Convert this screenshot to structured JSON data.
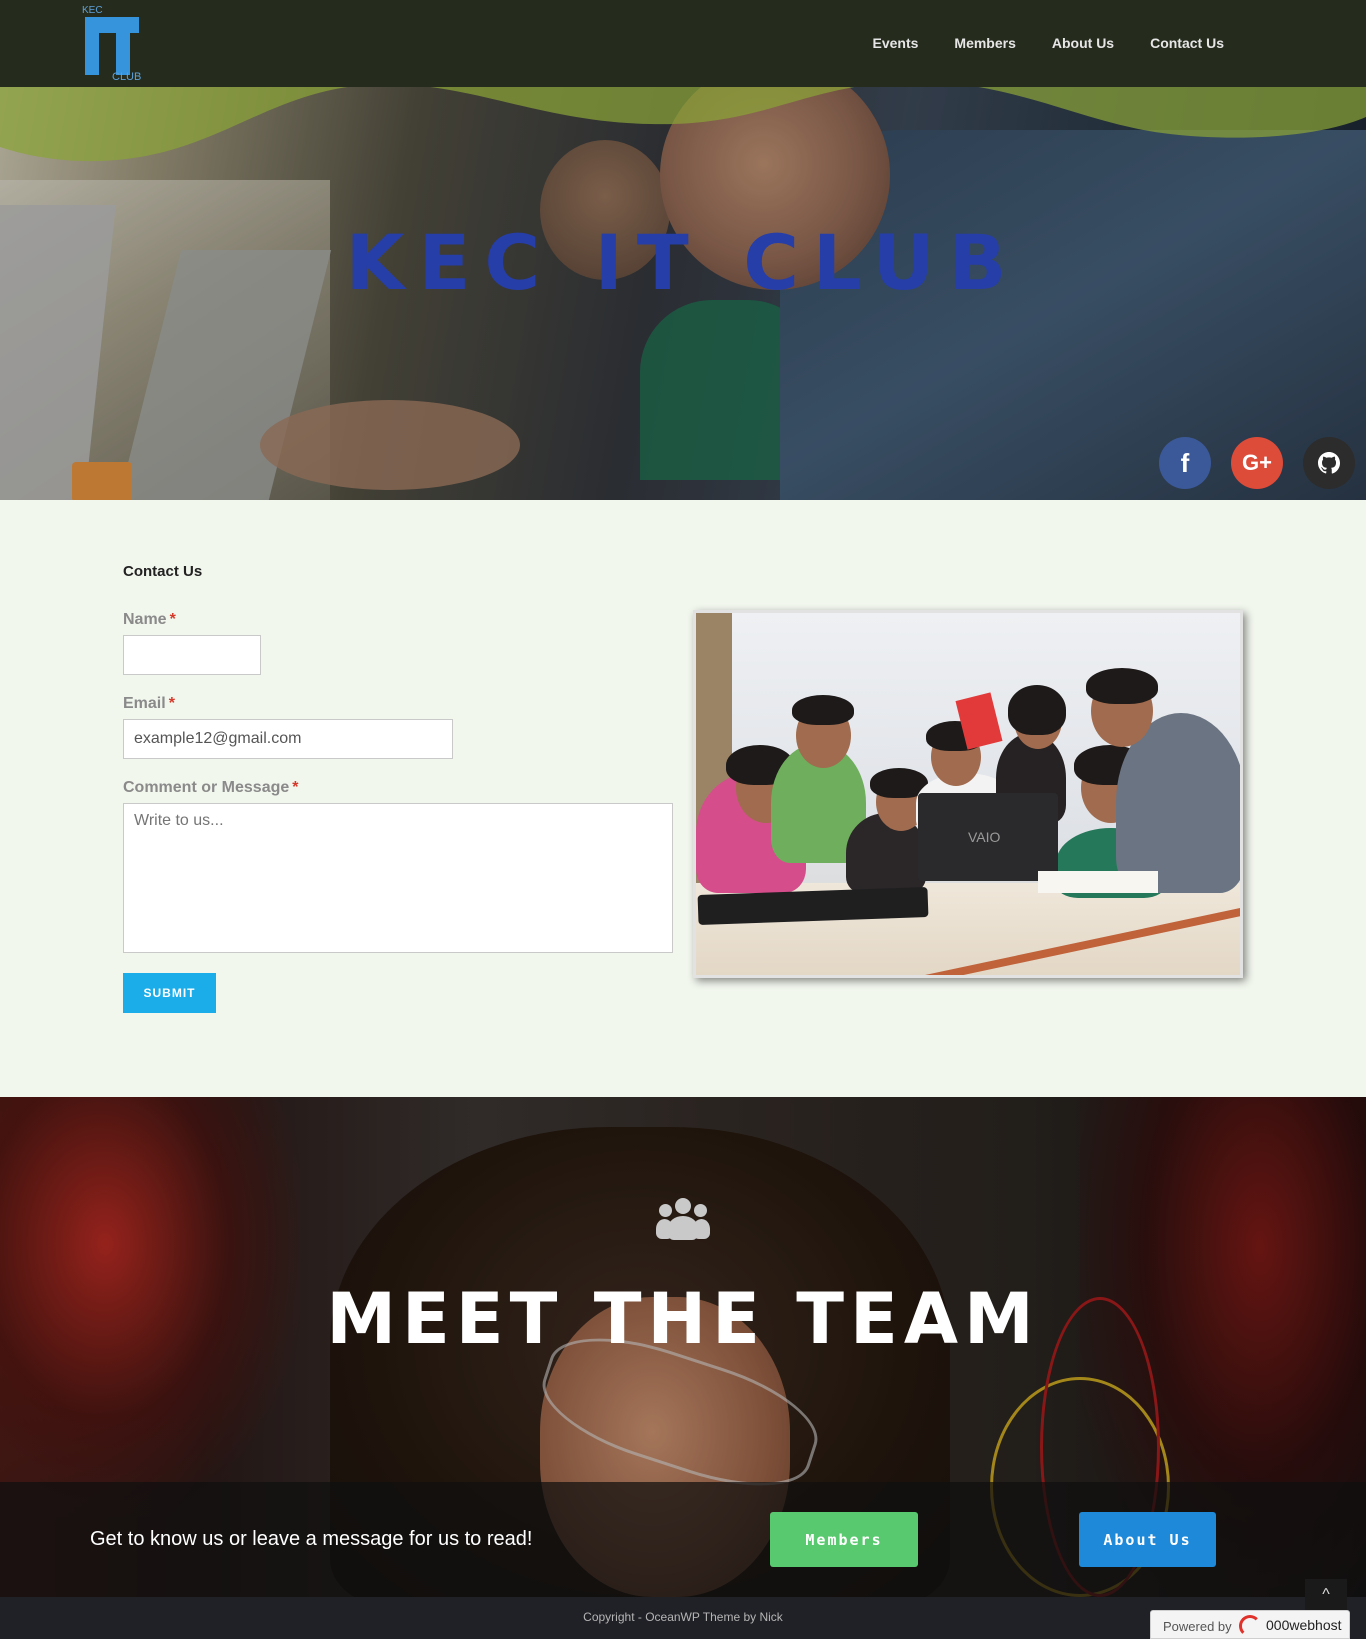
{
  "header": {
    "logo": {
      "top_text": "KEC",
      "main_text": "IT",
      "bottom_text": "CLUB"
    },
    "nav": [
      "Events",
      "Members",
      "About Us",
      "Contact Us"
    ]
  },
  "hero": {
    "title": "KEC IT CLUB",
    "socials": [
      {
        "name": "facebook",
        "glyph": "f",
        "color": "#3b5998"
      },
      {
        "name": "google-plus",
        "glyph": "G+",
        "color": "#dd4b39"
      },
      {
        "name": "github",
        "glyph": "●",
        "color": "#2c2c2c"
      }
    ]
  },
  "contact": {
    "heading": "Contact Us",
    "fields": {
      "name_label": "Name",
      "email_label": "Email",
      "email_value": "example12@gmail.com",
      "message_label": "Comment or Message",
      "message_placeholder": "Write to us...",
      "required_mark": "*"
    },
    "submit_label": "SUBMIT",
    "photo_laptop_brand": "VAIO"
  },
  "team": {
    "title": "MEET THE TEAM",
    "icon": "users-icon",
    "cta_text": "Get to know us or leave a message for us to read!",
    "buttons": {
      "members": "Members",
      "about": "About Us"
    }
  },
  "footer": {
    "copyright": "Copyright - OceanWP Theme by Nick",
    "scroll_top": "^",
    "powered_by": "Powered by",
    "host_brand": "000webhost"
  },
  "colors": {
    "nav_bg": "#252c1e",
    "wave": "#8aa338",
    "hero_title": "#263ea8",
    "submit": "#1bacea",
    "members_button": "#59c96f",
    "about_button": "#1e88d9",
    "required": "#d63a2a"
  }
}
